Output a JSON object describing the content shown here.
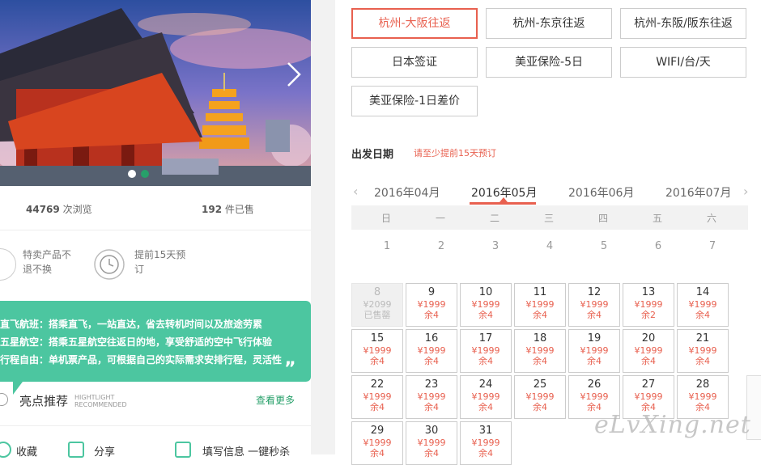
{
  "stats": {
    "views_num": "44769",
    "views_label": "次浏览",
    "sold_num": "192",
    "sold_label": "件已售"
  },
  "features": [
    {
      "text": "特卖产品不退不换"
    },
    {
      "text": "提前15天预订"
    }
  ],
  "highlights_box": [
    "直飞航班：搭乘直飞，一站直达，省去转机时间以及旅途劳累",
    "五星航空：搭乘五星航空往返日的地，享受舒适的空中飞行体验",
    "行程自由：单机票产品，可根据自己的实际需求安排行程，灵活性"
  ],
  "highlights_quote": "„",
  "highlight_section": {
    "title": "亮点推荐",
    "sub1": "HIGHTLIGHT",
    "sub2": "RECOMMENDED",
    "more": "查看更多"
  },
  "bottom_actions": {
    "collect": "收藏",
    "share": "分享",
    "fill": "填写信息 一键秒杀"
  },
  "options": [
    "杭州-大阪往返",
    "杭州-东京往返",
    "杭州-东阪/阪东往返",
    "日本签证",
    "美亚保险-5日",
    "WIFI/台/天",
    "美亚保险-1日差价"
  ],
  "date_section": {
    "label": "出发日期",
    "note": "请至少提前15天预订"
  },
  "months": [
    "2016年04月",
    "2016年05月",
    "2016年06月",
    "2016年07月"
  ],
  "active_month_index": 1,
  "weekdays": [
    "日",
    "一",
    "二",
    "三",
    "四",
    "五",
    "六"
  ],
  "prev_days": [
    "1",
    "2",
    "3",
    "4",
    "5",
    "6",
    "7"
  ],
  "calendar": [
    {
      "day": "8",
      "price": "¥2099",
      "stock": "已售罄",
      "disabled": true
    },
    {
      "day": "9",
      "price": "¥1999",
      "stock": "余4"
    },
    {
      "day": "10",
      "price": "¥1999",
      "stock": "余4"
    },
    {
      "day": "11",
      "price": "¥1999",
      "stock": "余4"
    },
    {
      "day": "12",
      "price": "¥1999",
      "stock": "余4"
    },
    {
      "day": "13",
      "price": "¥1999",
      "stock": "余2"
    },
    {
      "day": "14",
      "price": "¥1999",
      "stock": "余4"
    },
    {
      "day": "15",
      "price": "¥1999",
      "stock": "余4"
    },
    {
      "day": "16",
      "price": "¥1999",
      "stock": "余4"
    },
    {
      "day": "17",
      "price": "¥1999",
      "stock": "余4"
    },
    {
      "day": "18",
      "price": "¥1999",
      "stock": "余4"
    },
    {
      "day": "19",
      "price": "¥1999",
      "stock": "余4"
    },
    {
      "day": "20",
      "price": "¥1999",
      "stock": "余4"
    },
    {
      "day": "21",
      "price": "¥1999",
      "stock": "余4"
    },
    {
      "day": "22",
      "price": "¥1999",
      "stock": "余4"
    },
    {
      "day": "23",
      "price": "¥1999",
      "stock": "余4"
    },
    {
      "day": "24",
      "price": "¥1999",
      "stock": "余4"
    },
    {
      "day": "25",
      "price": "¥1999",
      "stock": "余4"
    },
    {
      "day": "26",
      "price": "¥1999",
      "stock": "余4"
    },
    {
      "day": "27",
      "price": "¥1999",
      "stock": "余4"
    },
    {
      "day": "28",
      "price": "¥1999",
      "stock": "余4"
    },
    {
      "day": "29",
      "price": "¥1999",
      "stock": "余4"
    },
    {
      "day": "30",
      "price": "¥1999",
      "stock": "余4"
    },
    {
      "day": "31",
      "price": "¥1999",
      "stock": "余4"
    }
  ],
  "watermark": "eLvXing.net",
  "colors": {
    "accent": "#e8604f",
    "green": "#4cc6a0"
  }
}
